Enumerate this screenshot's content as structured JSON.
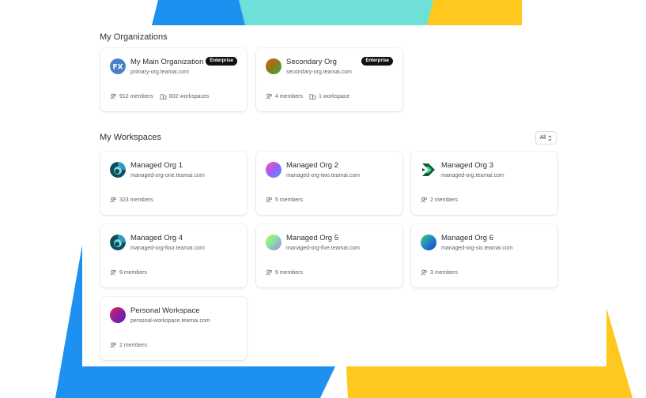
{
  "organizations": {
    "title": "My Organizations",
    "items": [
      {
        "name": "My Main Organization",
        "domain": "primary-org.teamai.com",
        "badge": "Enterprise",
        "members": "912 members",
        "workspaces": "802 workspaces"
      },
      {
        "name": "Secondary Org",
        "domain": "secondary-org.teamai.com",
        "badge": "Enterprise",
        "members": "4 members",
        "workspaces": "1 workspace"
      }
    ]
  },
  "workspaces": {
    "title": "My Workspaces",
    "filter_label": "All",
    "items": [
      {
        "name": "Managed Org 1",
        "domain": "managed-org-one.teamai.com",
        "members": "323 members"
      },
      {
        "name": "Managed Org 2",
        "domain": "managed-org-two.teamai.com",
        "members": "5 members"
      },
      {
        "name": "Managed Org 3",
        "domain": "managed-org.teamai.com",
        "members": "2 members"
      },
      {
        "name": "Managed Org 4",
        "domain": "managed-org-four.teamai.com",
        "members": "9 members"
      },
      {
        "name": "Managed Org 5",
        "domain": "managed-org-five.teamai.com",
        "members": "9 members"
      },
      {
        "name": "Managed Org 6",
        "domain": "managed-org-six.teamai.com",
        "members": "3 members"
      },
      {
        "name": "Personal Workspace",
        "domain": "personal-workspace.teamai.com",
        "members": "2 members"
      }
    ]
  },
  "colors": {
    "accent_blue": "#1e90f0",
    "accent_yellow": "#ffc81e",
    "accent_teal": "#6fe0d8",
    "badge_bg": "#111111"
  }
}
